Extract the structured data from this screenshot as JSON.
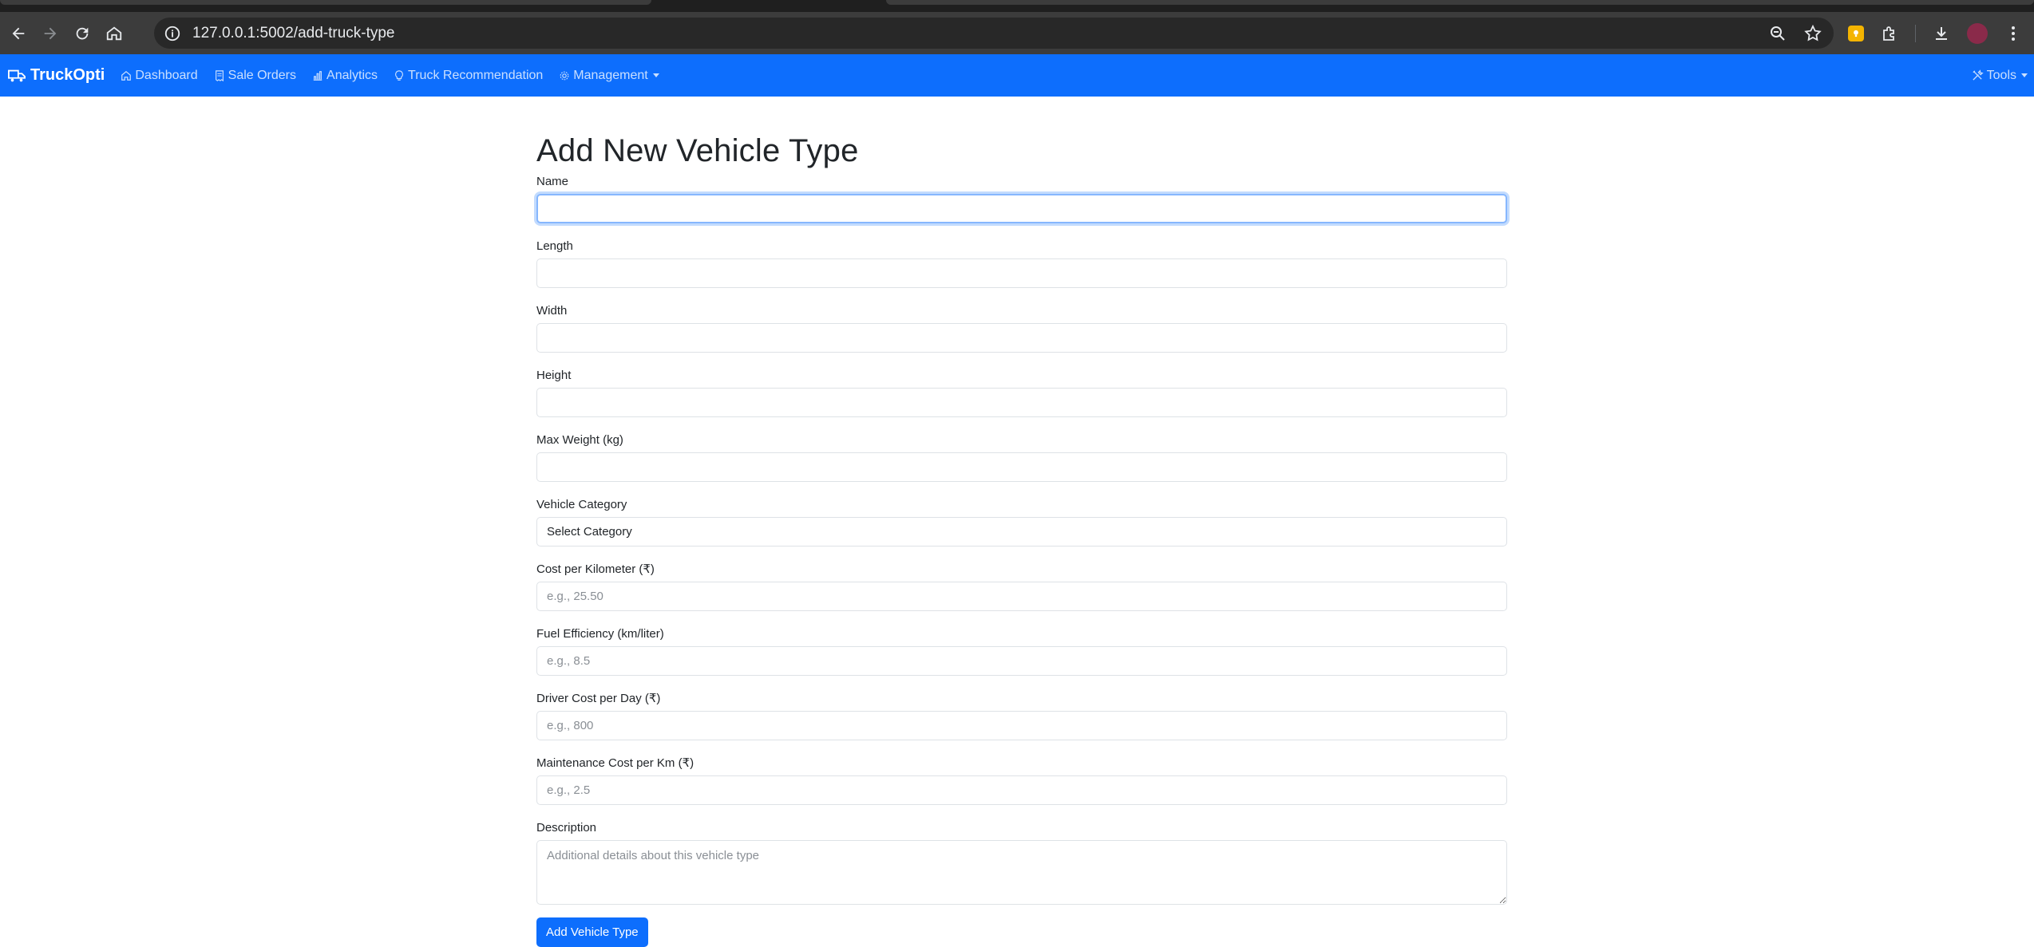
{
  "browser": {
    "url": "127.0.0.1:5002/add-truck-type"
  },
  "navbar": {
    "brand": "TruckOpti",
    "links": [
      "Dashboard",
      "Sale Orders",
      "Analytics",
      "Truck Recommendation",
      "Management"
    ],
    "tools": "Tools"
  },
  "form": {
    "title": "Add New Vehicle Type",
    "fields": [
      {
        "label": "Name",
        "placeholder": ""
      },
      {
        "label": "Length",
        "placeholder": ""
      },
      {
        "label": "Width",
        "placeholder": ""
      },
      {
        "label": "Height",
        "placeholder": ""
      },
      {
        "label": "Max Weight (kg)",
        "placeholder": ""
      },
      {
        "label": "Vehicle Category",
        "selected": "Select Category"
      },
      {
        "label": "Cost per Kilometer (₹)",
        "placeholder": "e.g., 25.50"
      },
      {
        "label": "Fuel Efficiency (km/liter)",
        "placeholder": "e.g., 8.5"
      },
      {
        "label": "Driver Cost per Day (₹)",
        "placeholder": "e.g., 800"
      },
      {
        "label": "Maintenance Cost per Km (₹)",
        "placeholder": "e.g., 2.5"
      },
      {
        "label": "Description",
        "placeholder": "Additional details about this vehicle type"
      }
    ],
    "submit": "Add Vehicle Type"
  },
  "colors": {
    "navbar": "#0d6efd",
    "button": "#0d6efd"
  }
}
